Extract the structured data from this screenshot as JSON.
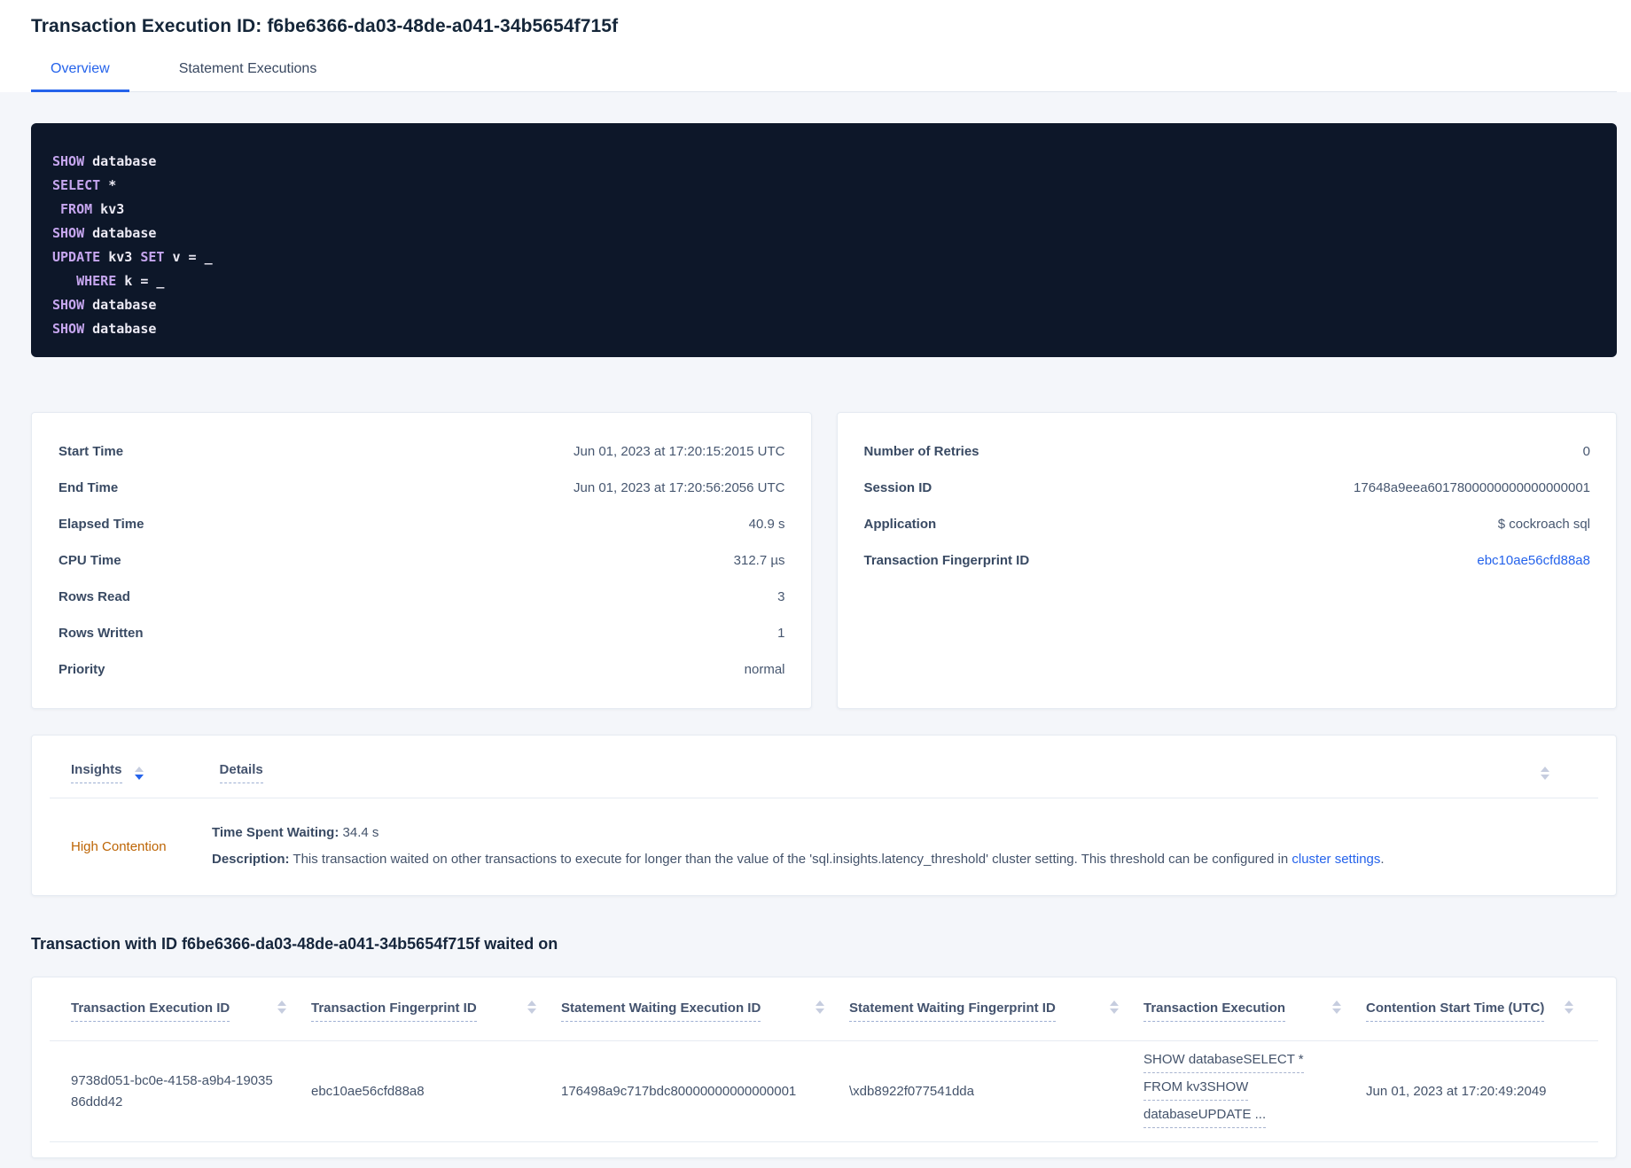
{
  "page": {
    "title": "Transaction Execution ID: f6be6366-da03-48de-a041-34b5654f715f"
  },
  "tabs": [
    {
      "label": "Overview",
      "active": true
    },
    {
      "label": "Statement Executions",
      "active": false
    }
  ],
  "sql": {
    "lines": [
      [
        {
          "k": true,
          "t": "SHOW"
        },
        {
          "k": false,
          "t": " database"
        }
      ],
      [
        {
          "k": true,
          "t": "SELECT"
        },
        {
          "k": false,
          "t": " *"
        }
      ],
      [
        {
          "k": false,
          "t": " "
        },
        {
          "k": true,
          "t": "FROM"
        },
        {
          "k": false,
          "t": " kv3"
        }
      ],
      [
        {
          "k": true,
          "t": "SHOW"
        },
        {
          "k": false,
          "t": " database"
        }
      ],
      [
        {
          "k": true,
          "t": "UPDATE"
        },
        {
          "k": false,
          "t": " kv3 "
        },
        {
          "k": true,
          "t": "SET"
        },
        {
          "k": false,
          "t": " v = _"
        }
      ],
      [
        {
          "k": false,
          "t": "   "
        },
        {
          "k": true,
          "t": "WHERE"
        },
        {
          "k": false,
          "t": " k = _"
        }
      ],
      [
        {
          "k": true,
          "t": "SHOW"
        },
        {
          "k": false,
          "t": " database"
        }
      ],
      [
        {
          "k": true,
          "t": "SHOW"
        },
        {
          "k": false,
          "t": " database"
        }
      ]
    ]
  },
  "summary_left": {
    "rows": [
      {
        "label": "Start Time",
        "value": "Jun 01, 2023 at 17:20:15:2015 UTC"
      },
      {
        "label": "End Time",
        "value": "Jun 01, 2023 at 17:20:56:2056 UTC"
      },
      {
        "label": "Elapsed Time",
        "value": "40.9 s"
      },
      {
        "label": "CPU Time",
        "value": "312.7 µs"
      },
      {
        "label": "Rows Read",
        "value": "3"
      },
      {
        "label": "Rows Written",
        "value": "1"
      },
      {
        "label": "Priority",
        "value": "normal"
      }
    ]
  },
  "summary_right": {
    "rows": [
      {
        "label": "Number of Retries",
        "value": "0"
      },
      {
        "label": "Session ID",
        "value": "17648a9eea6017800000000000000001"
      },
      {
        "label": "Application",
        "value": "$ cockroach sql"
      },
      {
        "label": "Transaction Fingerprint ID",
        "value": "ebc10ae56cfd88a8"
      }
    ]
  },
  "insights": {
    "col_insights": "Insights",
    "col_details": "Details",
    "row": {
      "insight": "High Contention",
      "waiting_label": "Time Spent Waiting:",
      "waiting_value": " 34.4 s",
      "desc_label": "Description:",
      "desc_text": " This transaction waited on other transactions to execute for longer than the value of the 'sql.insights.latency_threshold' cluster setting. This threshold can be configured in ",
      "desc_link": "cluster settings",
      "desc_suffix": "."
    }
  },
  "waited_on": {
    "heading": "Transaction with ID f6be6366-da03-48de-a041-34b5654f715f waited on",
    "columns": [
      "Transaction Execution ID",
      "Transaction Fingerprint ID",
      "Statement Waiting Execution ID",
      "Statement Waiting Fingerprint ID",
      "Transaction Execution",
      "Contention Start Time (UTC)"
    ],
    "rows": [
      {
        "transaction_execution_id": "9738d051-bc0e-4158-a9b4-1903586ddd42",
        "transaction_fingerprint_id": "ebc10ae56cfd88a8",
        "statement_waiting_execution_id": "176498a9c717bdc80000000000000001",
        "statement_waiting_fingerprint_id": "\\xdb8922f077541dda",
        "transaction_execution_lines": [
          "SHOW databaseSELECT *",
          "FROM kv3SHOW",
          "databaseUPDATE ..."
        ],
        "contention_start_time": "Jun 01, 2023 at 17:20:49:2049"
      }
    ]
  },
  "colors": {
    "accent_blue": "#2563eb",
    "insight_orange": "#bd6505",
    "code_background": "#0d1729",
    "code_keyword": "#c6a6ef",
    "code_text": "#eceaf4",
    "page_background": "#f4f6fa"
  }
}
